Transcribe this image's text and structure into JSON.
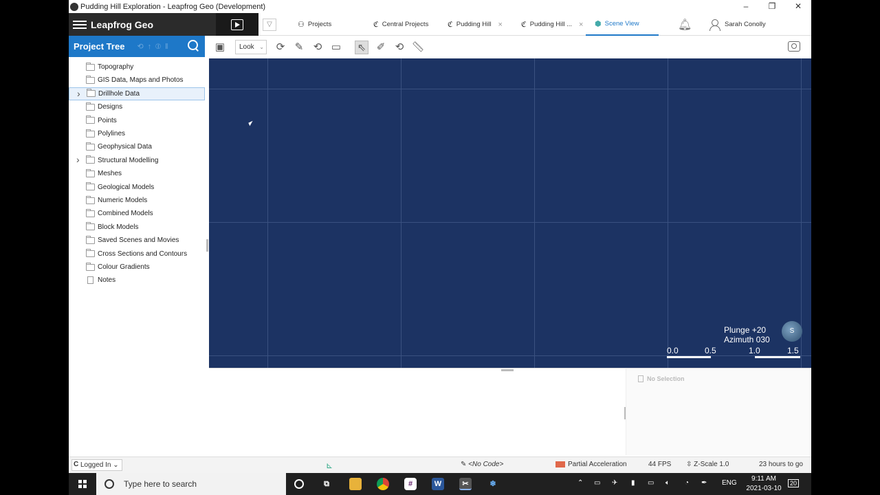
{
  "window": {
    "title": "Pudding Hill Exploration - Leapfrog Geo (Development)",
    "controls": [
      "–",
      "❐",
      "✕"
    ]
  },
  "nav": {
    "brand": "Leapfrog Geo",
    "tabs": [
      {
        "label": "Projects",
        "icon": "projects-icon"
      },
      {
        "label": "Central Projects",
        "icon": "central-icon"
      },
      {
        "label": "Pudding Hill",
        "icon": "central-icon",
        "close": "×"
      },
      {
        "label": "Pudding Hill ...",
        "icon": "central-icon",
        "close": "×"
      },
      {
        "label": "Scene View",
        "icon": "scene-icon",
        "active": true
      }
    ],
    "user": "Sarah Conolly"
  },
  "project_tree": {
    "title": "Project Tree",
    "items": [
      {
        "label": "Topography",
        "expandable": false
      },
      {
        "label": "GIS Data, Maps and Photos",
        "expandable": false
      },
      {
        "label": "Drillhole Data",
        "expandable": true,
        "selected": true
      },
      {
        "label": "Designs",
        "expandable": false
      },
      {
        "label": "Points",
        "expandable": false
      },
      {
        "label": "Polylines",
        "expandable": false
      },
      {
        "label": "Geophysical Data",
        "expandable": false
      },
      {
        "label": "Structural Modelling",
        "expandable": true
      },
      {
        "label": "Meshes",
        "expandable": false
      },
      {
        "label": "Geological Models",
        "expandable": false
      },
      {
        "label": "Numeric Models",
        "expandable": false
      },
      {
        "label": "Combined Models",
        "expandable": false
      },
      {
        "label": "Block Models",
        "expandable": false
      },
      {
        "label": "Saved Scenes and Movies",
        "expandable": false
      },
      {
        "label": "Cross Sections and Contours",
        "expandable": false
      },
      {
        "label": "Colour Gradients",
        "expandable": false
      },
      {
        "label": "Notes",
        "expandable": false,
        "type": "note"
      }
    ]
  },
  "toolbar": {
    "look_label": "Look"
  },
  "scene": {
    "plunge": "Plunge +20",
    "azimuth": "Azimuth 030",
    "globe_label": "S",
    "scale_labels": [
      "0.0",
      "0.5",
      "1.0",
      "1.5"
    ],
    "background": "#1c3363"
  },
  "selection": {
    "label": "No Selection"
  },
  "status": {
    "logged_in": "Logged In",
    "code": "<No Code>",
    "acceleration": "Partial Acceleration",
    "fps": "44 FPS",
    "zscale": "Z-Scale 1.0",
    "remaining": "23 hours to go"
  },
  "taskbar": {
    "search_placeholder": "Type here to search",
    "lang": "ENG",
    "time": "9:11 AM",
    "date": "2021-03-10",
    "notifications": "20"
  }
}
